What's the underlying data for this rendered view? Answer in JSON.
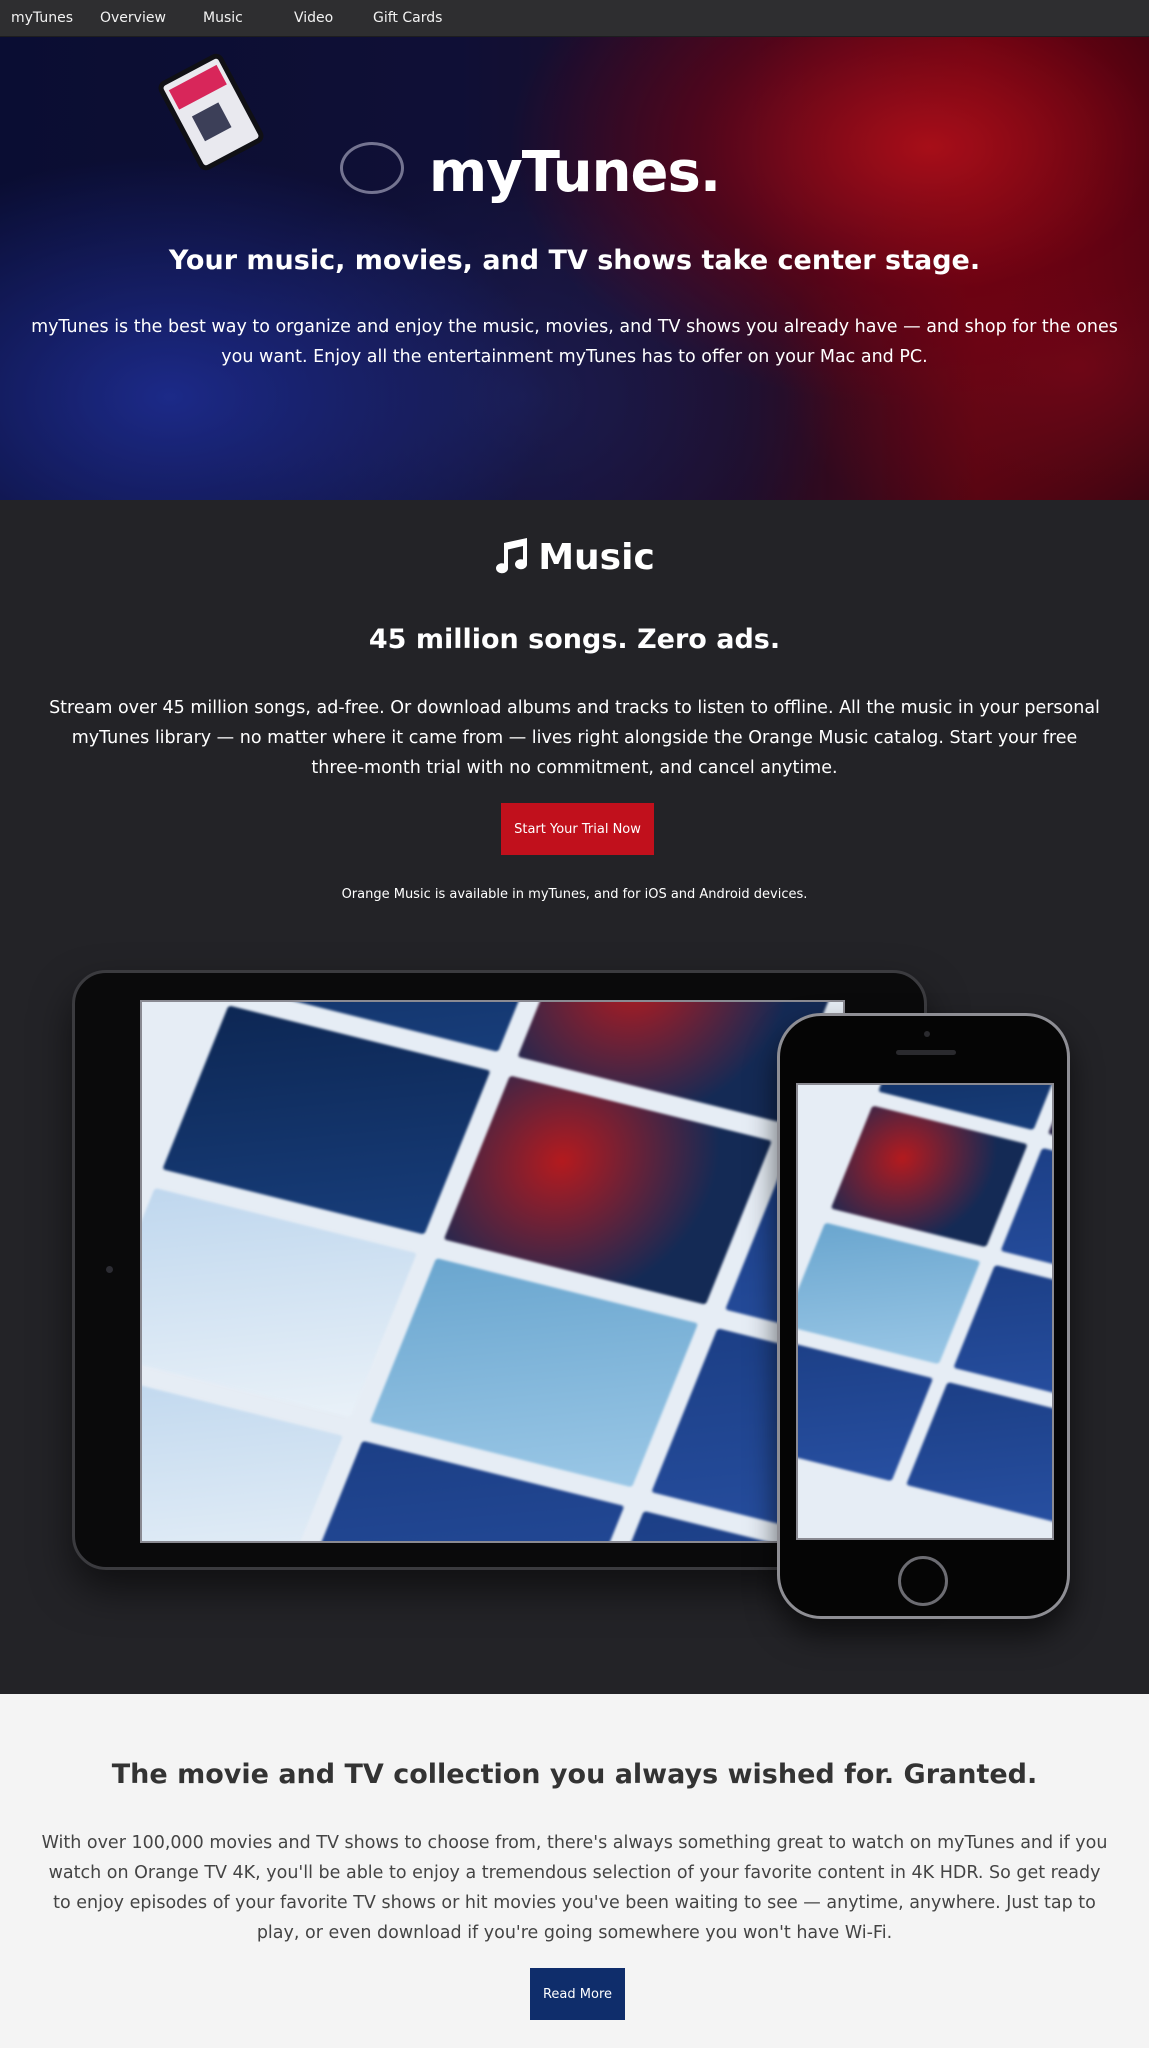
{
  "nav": {
    "brand": "myTunes",
    "items": [
      "Overview",
      "Music",
      "Video",
      "Gift Cards"
    ]
  },
  "hero": {
    "title": "myTunes.",
    "subtitle": "Your music, movies, and TV shows take center stage.",
    "description": "myTunes is the best way to organize and enjoy the music, movies, and TV shows you already have — and shop for the ones you want. Enjoy all the entertainment myTunes has to offer on your Mac and PC."
  },
  "music": {
    "icon": "music-note-icon",
    "heading": "Music",
    "tagline": "45 million songs. Zero ads.",
    "description": "Stream over 45 million songs, ad-free. Or download albums and tracks to listen to offline. All the music in your personal myTunes library — no matter where it came from — lives right alongside the Orange Music catalog. Start your free three-month trial with no commitment, and cancel anytime.",
    "cta_label": "Start Your Trial Now",
    "availability_note": "Orange Music is available in myTunes, and for iOS and Android devices.",
    "accent_color": "#c1101c"
  },
  "movies": {
    "heading": "The movie and TV collection you always wished for. Granted.",
    "description": "With over 100,000 movies and TV shows to choose from, there's always something great to watch on myTunes and if you watch on Orange TV 4K, you'll be able to enjoy a tremendous selection of your favorite content in 4K HDR. So get ready to enjoy episodes of your favorite TV shows or hit movies you've been waiting to see — anytime, anywhere. Just tap to play, or even download if you're going somewhere you won't have Wi-Fi.",
    "cta_label": "Read More",
    "accent_color": "#0f2d6b"
  }
}
